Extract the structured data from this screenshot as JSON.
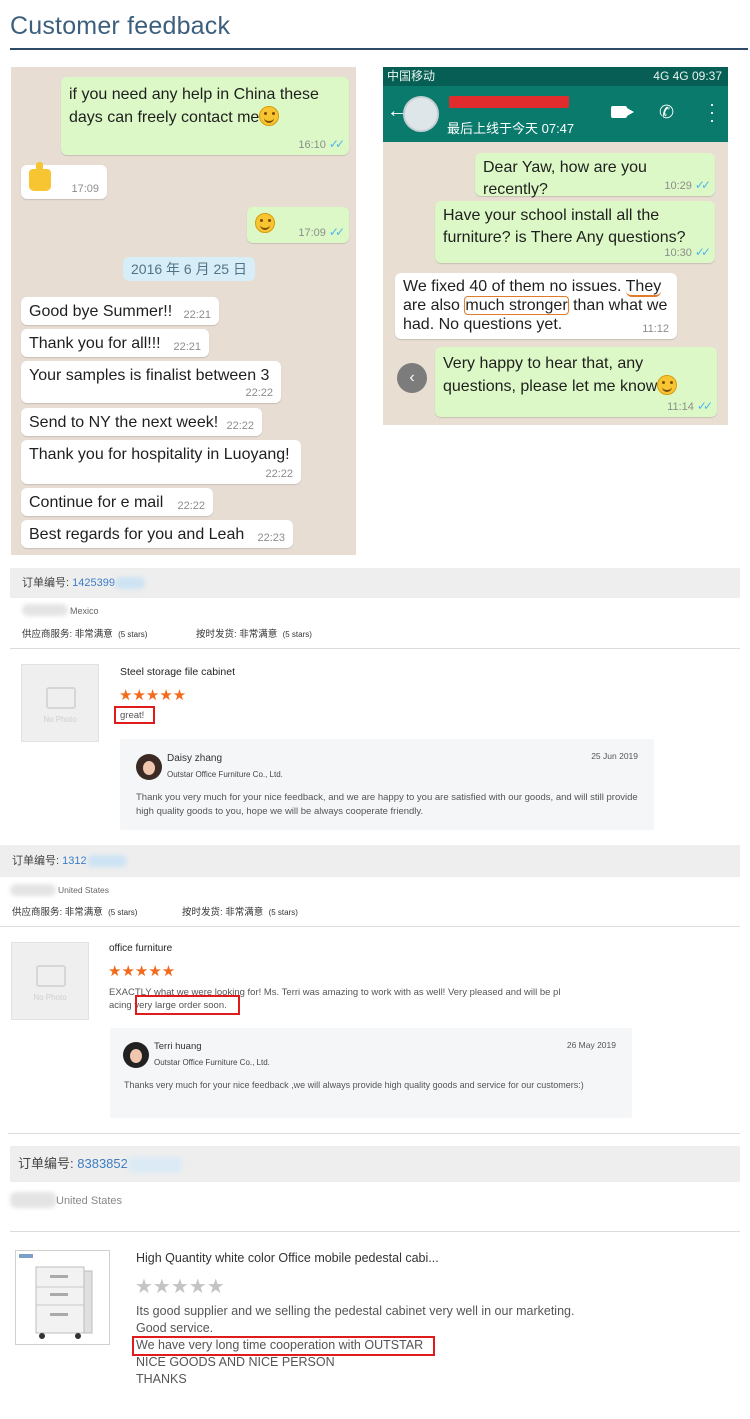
{
  "page_title": "Customer feedback",
  "chat1": {
    "messages": [
      {
        "text": "if you need any help in China these days can freely contact me",
        "time": "16:10"
      },
      {
        "time": "17:09"
      },
      {
        "time": "17:09"
      },
      {
        "text": "Good bye Summer!!",
        "time": "22:21"
      },
      {
        "text": "Thank you for all!!!",
        "time": "22:21"
      },
      {
        "text": "Your samples is finalist between 3",
        "time": "22:22"
      },
      {
        "text": "Send to NY the next week!",
        "time": "22:22"
      },
      {
        "text": "Thank you for hospitality in Luoyang!",
        "time": "22:22"
      },
      {
        "text": "Continue for e mail",
        "time": "22:22"
      },
      {
        "text": "Best regards for you and Leah",
        "time": "22:23"
      }
    ],
    "date_chip": "2016 年 6 月 25 日"
  },
  "chat2": {
    "status_left": "中国移动",
    "status_right": "4G 4G 09:37",
    "last_seen": "最后上线于今天 07:47",
    "messages": [
      {
        "text": "Dear Yaw, how are you recently?",
        "time": "10:29"
      },
      {
        "text": "Have your school install all the furniture? is There Any questions?",
        "time": "10:30"
      },
      {
        "text_a": "We fixed 40 of them no issues. ",
        "text_u1": "They",
        "text_b": " are also ",
        "text_u2": "much stronger",
        "text_c": " than what we had. No questions yet.",
        "time": "11:12"
      },
      {
        "text": "Very happy to hear that, any questions, please let me know",
        "time": "11:14"
      }
    ]
  },
  "orders": [
    {
      "order_label": "订单编号:",
      "order_no": "1425399",
      "country": "Mexico",
      "service_label": "供应商服务: 非常满意",
      "service_stars": "(5 stars)",
      "ship_label": "按时发货: 非常满意",
      "ship_stars": "(5 stars)",
      "product": "Steel storage file cabinet",
      "rating": 5,
      "review": "great!",
      "reply": {
        "name": "Daisy zhang",
        "company": "Outstar Office Furniture Co., Ltd.",
        "date": "25 Jun 2019",
        "text": "Thank you very much for your nice feedback, and we are happy to you are satisfied with our goods, and will still provide high quality goods to you, hope we will be always cooperate friendly."
      }
    },
    {
      "order_label": "订单编号:",
      "order_no": "1312",
      "country": "United States",
      "service_label": "供应商服务: 非常满意",
      "service_stars": "(5 stars)",
      "ship_label": "按时发货: 非常满意",
      "ship_stars": "(5 stars)",
      "product": "office furniture",
      "rating": 5,
      "review_a": "EXACTLY what we were looking for! Ms. Terri was amazing to work with as well! Very pleased and will be pl",
      "review_b": "acing ",
      "review_highlight": "very large order soon.",
      "reply": {
        "name": "Terri huang",
        "company": "Outstar Office Furniture Co., Ltd.",
        "date": "26 May 2019",
        "text": "Thanks very much for your nice feedback ,we will always provide high quality goods and service for our customers:)"
      }
    },
    {
      "order_label": "订单编号:",
      "order_no": "8383852",
      "country": "United States",
      "product": "High Quantity white color Office mobile pedestal cabi...",
      "rating": 0,
      "review_lines": [
        "Its good supplier and we selling the pedestal cabinet very well in our marketing.",
        "Good service.",
        "We have very long time cooperation with OUTSTAR",
        "NICE GOODS AND NICE PERSON",
        "THANKS"
      ]
    }
  ],
  "no_photo": "No Photo",
  "stars_glyph": "★★★★★"
}
